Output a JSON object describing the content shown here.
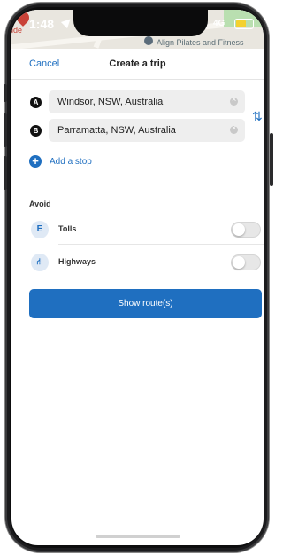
{
  "status_bar": {
    "time": "1:48",
    "signal": "4G",
    "map_label": "Align Pilates and Fitness",
    "map_label_left": "ide"
  },
  "header": {
    "cancel_label": "Cancel",
    "title": "Create a trip"
  },
  "route": {
    "stops": [
      {
        "badge": "A",
        "value": "Windsor, NSW, Australia"
      },
      {
        "badge": "B",
        "value": "Parramatta, NSW, Australia"
      }
    ],
    "add_stop_label": "Add a stop"
  },
  "avoid": {
    "heading": "Avoid",
    "options": [
      {
        "label": "Tolls",
        "icon_glyph": "E",
        "icon": "toll-icon",
        "enabled": false
      },
      {
        "label": "Highways",
        "icon_glyph": "⛙",
        "icon": "highway-icon",
        "enabled": false
      }
    ]
  },
  "actions": {
    "show_routes_label": "Show route(s)"
  },
  "colors": {
    "accent": "#1f6fc0",
    "battery": "#f4d130"
  }
}
